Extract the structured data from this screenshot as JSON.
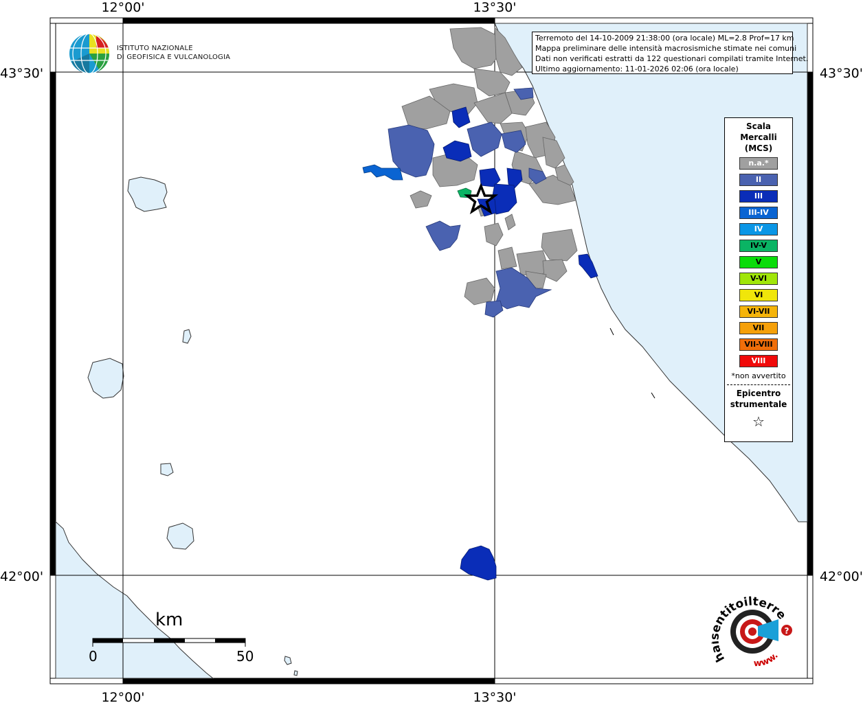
{
  "coords": {
    "lon_left": "12°00'",
    "lon_right": "13°30'",
    "lat_top": "43°30'",
    "lat_bottom": "42°00'"
  },
  "info_box": {
    "line1": "Terremoto del 14-10-2009 21:38:00 (ora locale) ML=2.8 Prof=17 km",
    "line2": "Mappa preliminare delle intensità macrosismiche stimate nei comuni",
    "line3": "Dati non verificati estratti da 122 questionari compilati tramite Internet.",
    "line4": "Ultimo aggiornamento: 11-01-2026 02:06 (ora locale)"
  },
  "institute": {
    "line1": "ISTITUTO NAZIONALE",
    "line2": "DI GEOFISICA E VULCANOLOGIA"
  },
  "legend": {
    "title1": "Scala",
    "title2": "Mercalli",
    "title3": "(MCS)",
    "items": [
      {
        "label": "n.a.*",
        "color": "#a0a0a0",
        "text": "#ffffff"
      },
      {
        "label": "II",
        "color": "#4a62b0",
        "text": "#ffffff"
      },
      {
        "label": "III",
        "color": "#0a2db8",
        "text": "#ffffff"
      },
      {
        "label": "III-IV",
        "color": "#0a64d2",
        "text": "#ffffff"
      },
      {
        "label": "IV",
        "color": "#0a96e6",
        "text": "#ffffff"
      },
      {
        "label": "IV-V",
        "color": "#0ab464",
        "text": "#000000"
      },
      {
        "label": "V",
        "color": "#0adc0a",
        "text": "#000000"
      },
      {
        "label": "V-VI",
        "color": "#a0e60a",
        "text": "#000000"
      },
      {
        "label": "VI",
        "color": "#f0e60a",
        "text": "#000000"
      },
      {
        "label": "VI-VII",
        "color": "#f5b40a",
        "text": "#000000"
      },
      {
        "label": "VII",
        "color": "#f5a00a",
        "text": "#000000"
      },
      {
        "label": "VII-VIII",
        "color": "#f06e0a",
        "text": "#000000"
      },
      {
        "label": "VIII",
        "color": "#f00a0a",
        "text": "#ffffff"
      }
    ],
    "not_felt": "*non avvertito",
    "epicenter1": "Epicentro",
    "epicenter2": "strumentale",
    "star": "☆"
  },
  "scale_bar": {
    "unit": "km",
    "min": "0",
    "max": "50"
  },
  "colors": {
    "sea": "#e0f0fa",
    "land": "#ffffff",
    "na": "#a0a0a0",
    "II": "#4a62b0",
    "III": "#0a2db8",
    "III_IV": "#0a64d2",
    "IV_V": "#0ab464"
  },
  "site_logo": {
    "text": "haisentitoilterremoto.it",
    "url_text": "www."
  }
}
